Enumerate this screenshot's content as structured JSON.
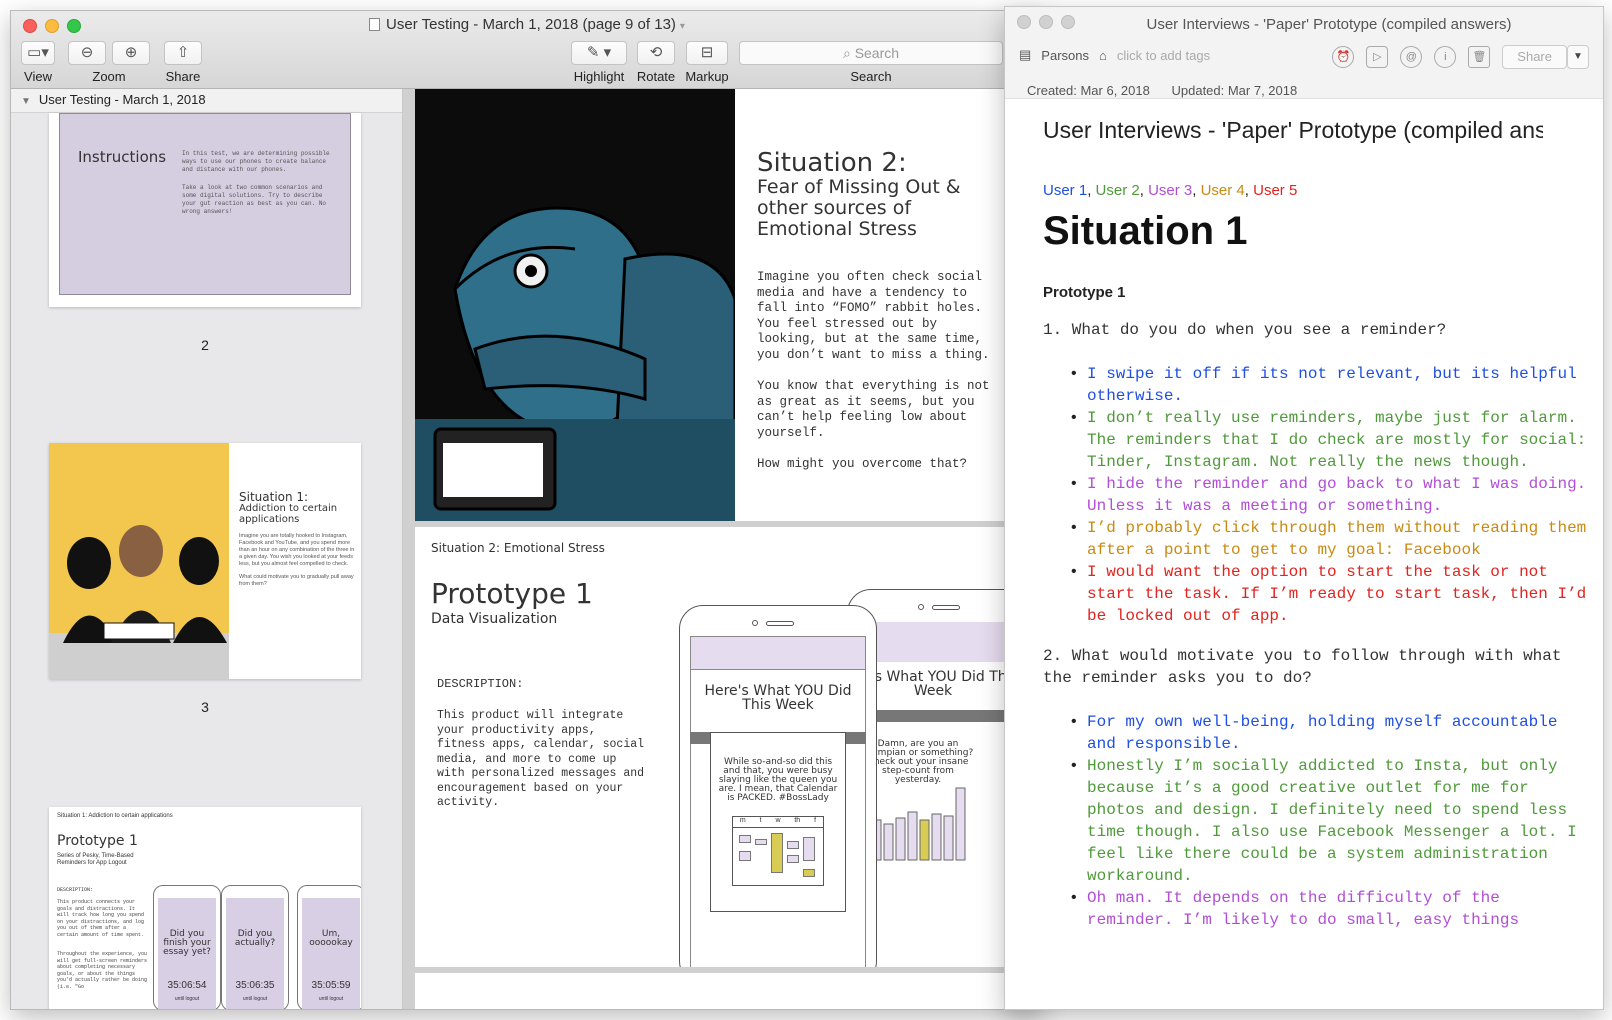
{
  "preview": {
    "title": "User Testing - March 1, 2018 (page 9 of 13)",
    "toolbar": {
      "view": "View",
      "zoom": "Zoom",
      "share": "Share",
      "highlight": "Highlight",
      "rotate": "Rotate",
      "markup": "Markup",
      "search_placeholder": "Search",
      "search_label": "Search"
    },
    "sidebar": {
      "header": "User Testing - March 1, 2018",
      "page_numbers": [
        "2",
        "3"
      ],
      "thumb2": {
        "title": "Instructions",
        "text1": "In this test, we are determining possible ways to use our phones to create balance and distance with our phones.",
        "text2": "Take a look at two common scenarios and some digital solutions. Try to describe your gut reaction as best as you can. No wrong answers!"
      },
      "thumb3": {
        "title": "Situation 1:",
        "subtitle": "Addiction to certain applications",
        "text1": "Imagine you are totally hooked to Instagram, Facebook and YouTube, and you spend more than an hour on any combination of the three in a given day. You wish you looked at your feeds less, but you almost feel compelled to check.",
        "text2": "What could motivate you to gradually pull away from them?"
      },
      "thumb4": {
        "header": "Situation 1: Addiction to certain applications",
        "title": "Prototype 1",
        "subtitle": "Series of Pesky, Time-Based Reminders for App Logout",
        "desc_label": "DESCRIPTION:",
        "desc": "This product connects your goals and distractions. It will track how long you spend on your distractions, and log you out of them after a certain amount of time spent.",
        "desc2": "Throughout the experience, you will get full-screen reminders about completing necessary goals, or about the things you'd actually rather be doing (i.e. \"Go",
        "phones": [
          {
            "q": "Did you finish your essay yet?",
            "time": "35:06:54",
            "foot": "until logout"
          },
          {
            "q": "Did you actually?",
            "time": "35:06:35",
            "foot": "until logout"
          },
          {
            "q": "Um, oooookay",
            "time": "35:05:59",
            "foot": "until logout"
          }
        ]
      }
    },
    "page_a": {
      "title": "Situation 2:",
      "subtitle": "Fear of Missing Out & other sources of Emotional Stress",
      "para1": "Imagine you often check social media and have a tendency to fall into “FOMO” rabbit holes. You feel stressed out by looking, but at the same time, you don’t want to miss a thing.",
      "para2": "You know that everything is not as great as it seems, but you can’t help feeling low about yourself.",
      "para3": "How might you overcome that?"
    },
    "page_b": {
      "header": "Situation 2: Emotional Stress",
      "title": "Prototype 1",
      "subtitle": "Data Visualization",
      "desc_label": "DESCRIPTION:",
      "desc": "This product will integrate your productivity apps, fitness apps, calendar, social media, and more to come up with personalized messages and encouragement based on your activity.",
      "phone1_title": "Here's What YOU Did This Week",
      "phone1_msg": "While so-and-so did this and that, you were busy slaying like the queen you are. I mean, that Calendar is PACKED. #BossLady",
      "phone1_days": [
        "m",
        "t",
        "w",
        "th",
        "f"
      ],
      "phone2_title": "ere's What YOU Did This Week",
      "phone2_msg": "Damn, are you an Olympian or something? Check out your insane step-count from yesterday."
    }
  },
  "bear": {
    "title": "User Interviews - 'Paper' Prototype (compiled answers)",
    "tag_note": "Parsons",
    "tag_placeholder": "click to add tags",
    "share": "Share",
    "created": "Created: Mar 6, 2018",
    "updated": "Updated: Mar 7, 2018",
    "note_title": "User Interviews - 'Paper' Prototype (compiled answ",
    "users": [
      {
        "name": "User 1",
        "color": "#1f4fe0"
      },
      {
        "name": "User 2",
        "color": "#4f9a3a"
      },
      {
        "name": "User 3",
        "color": "#b24ed6"
      },
      {
        "name": "User 4",
        "color": "#c98a12"
      },
      {
        "name": "User 5",
        "color": "#e0241f"
      }
    ],
    "situation": "Situation 1",
    "prototype": "Prototype 1",
    "q1": "1. What do you do when you see a reminder?",
    "q1_answers": [
      {
        "text": "I swipe it off if its not relevant, but its helpful otherwise.",
        "color": "#1f4fe0"
      },
      {
        "text": "I don’t really use reminders, maybe just for alarm. The reminders that I do check are mostly for social: Tinder, Instagram. Not really the news though.",
        "color": "#4f9a3a"
      },
      {
        "text": "I hide the reminder and go back to what I was doing. Unless it was a meeting or something.",
        "color": "#b24ed6"
      },
      {
        "text": "I’d probably click through them without reading them after a point to get to my goal: Facebook",
        "color": "#c98a12"
      },
      {
        "text": "I would want the option to start the task or not start the task. If I’m ready to start task, then I’d be locked out of app.",
        "color": "#e0241f"
      }
    ],
    "q2": "2. What would motivate you to follow through with what the reminder asks you to do?",
    "q2_answers": [
      {
        "text": "For my own well-being, holding myself accountable and responsible.",
        "color": "#1f4fe0"
      },
      {
        "text": "Honestly I’m socially addicted to Insta, but only because it’s a good creative outlet for me for photos and design. I definitely need to spend less time though. I also use Facebook Messenger a lot. I feel like there could be a system administration workaround.",
        "color": "#4f9a3a"
      },
      {
        "text": "Oh man. It depends on the difficulty of the reminder. I’m likely to do small, easy things",
        "color": "#b24ed6"
      }
    ]
  }
}
